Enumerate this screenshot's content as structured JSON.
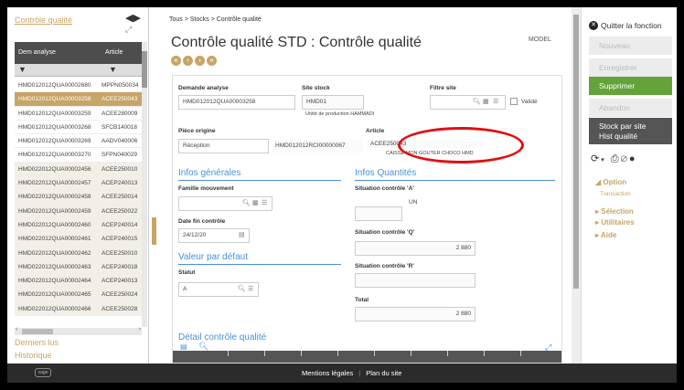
{
  "left_panel": {
    "title": "Contrôle qualité",
    "icons": [
      "previous-icon",
      "next-icon",
      "expand-icon"
    ],
    "columns": [
      "Dem analyse",
      "Article"
    ],
    "rows": [
      {
        "dem": "HMD012012QUA00002680",
        "article": "MPPN050034"
      },
      {
        "dem": "HMD012012QUA00003258",
        "article": "ACEE250043"
      },
      {
        "dem": "HMD012012QUA00003259",
        "article": "ACEE280009"
      },
      {
        "dem": "HMD012012QUA00003268",
        "article": "SFCB140018"
      },
      {
        "dem": "HMD012012QUA00003269",
        "article": "AADV040006"
      },
      {
        "dem": "HMD012012QUA00003270",
        "article": "SFPN040029"
      },
      {
        "dem": "HMD022012QUA00002456",
        "article": "ACEE250010"
      },
      {
        "dem": "HMD022012QUA00002457",
        "article": "ACEP240013"
      },
      {
        "dem": "HMD022012QUA00002458",
        "article": "ACEE250014"
      },
      {
        "dem": "HMD022012QUA00002459",
        "article": "ACEE250022"
      },
      {
        "dem": "HMD022012QUA00002460",
        "article": "ACEP240014"
      },
      {
        "dem": "HMD022012QUA00002461",
        "article": "ACEP240015"
      },
      {
        "dem": "HMD022012QUA00002462",
        "article": "ACEE250010"
      },
      {
        "dem": "HMD022012QUA00002463",
        "article": "ACEP240018"
      },
      {
        "dem": "HMD022012QUA00002464",
        "article": "ACEP240013"
      },
      {
        "dem": "HMD022012QUA00002465",
        "article": "ACEE250024"
      },
      {
        "dem": "HMD022012QUA00002466",
        "article": "ACEE250028"
      }
    ],
    "selected_index": 1,
    "links": [
      "Derniers lus",
      "Historique"
    ]
  },
  "header": {
    "breadcrumb": "Tous >  Stocks >  Contrôle qualité",
    "title": "Contrôle qualité STD : Contrôle qualité",
    "model": "MODEL"
  },
  "form": {
    "demande_label": "Demande analyse",
    "demande_value": "HMD012012QUA00003258",
    "site_label": "Site stock",
    "site_value": "HMD01",
    "site_desc": "Unité de production HAMMADI",
    "filtre_label": "Filtre site",
    "valide_label": "Validé",
    "piece_label": "Pièce origine",
    "piece_value": "Réception",
    "piece_ref": "HMD012012RCI00000067",
    "article_label": "Article",
    "article_value": "ACEE250043",
    "article_desc": "CAISSE MON GOUTER CHOCO HMD",
    "infos_generales": "Infos générales",
    "famille_label": "Famille mouvement",
    "date_label": "Date fin contrôle",
    "date_value": "24/12/20",
    "valeur_defaut": "Valeur par défaut",
    "statut_label": "Statut",
    "statut_value": "A",
    "infos_quantites": "Infos Quantités",
    "sit_a_label": "Situation contrôle 'A'",
    "unit": "UN",
    "sit_q_label": "Situation contrôle 'Q'",
    "sit_q_value": "2 880",
    "sit_r_label": "Situation contrôle 'R'",
    "total_label": "Total",
    "total_value": "2 880",
    "detail_title": "Détail contrôle qualité"
  },
  "right_panel": {
    "quit_label": "Quitter la fonction",
    "buttons": [
      {
        "label": "Nouveau",
        "state": "disabled"
      },
      {
        "label": "Enregistrer",
        "state": "disabled"
      },
      {
        "label": "Supprimer",
        "state": "primary"
      },
      {
        "label": "Abandon",
        "state": "disabled"
      }
    ],
    "stock_par_site": "Stock par site",
    "hist_qualite": "Hist qualité",
    "option_label": "Option",
    "transaction_label": "Transaction",
    "selection_label": "Sélection",
    "utilitaires_label": "Utilitaires",
    "aide_label": "Aide"
  },
  "footer": {
    "logo": "sage",
    "mentions": "Mentions légales",
    "separator": "|",
    "plan": "Plan du site"
  },
  "colors": {
    "accent": "#c6a567",
    "blue": "#4a90d9",
    "green": "#62a33a",
    "highlight": "#e01010"
  }
}
